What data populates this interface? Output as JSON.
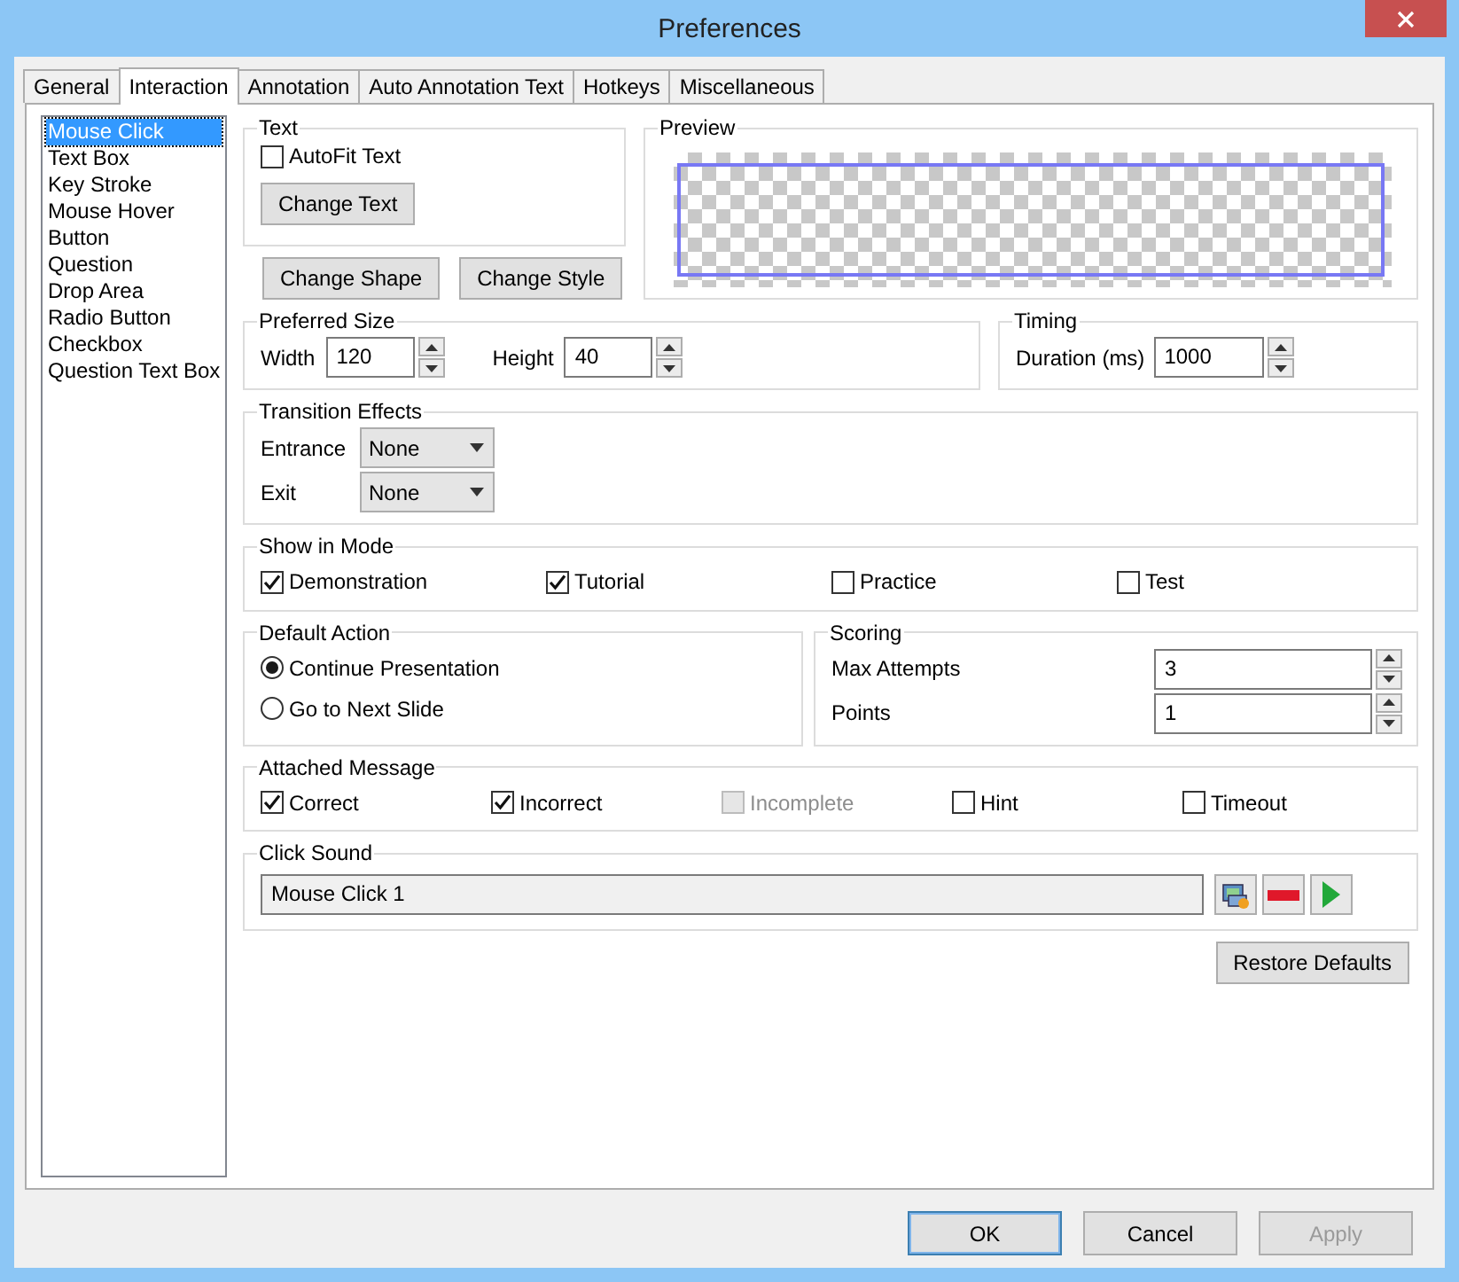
{
  "window": {
    "title": "Preferences"
  },
  "tabs": [
    {
      "label": "General",
      "selected": false
    },
    {
      "label": "Interaction",
      "selected": true
    },
    {
      "label": "Annotation",
      "selected": false
    },
    {
      "label": "Auto Annotation Text",
      "selected": false
    },
    {
      "label": "Hotkeys",
      "selected": false
    },
    {
      "label": "Miscellaneous",
      "selected": false
    }
  ],
  "sidebar": {
    "items": [
      {
        "label": "Mouse Click",
        "selected": true
      },
      {
        "label": "Text Box",
        "selected": false
      },
      {
        "label": "Key Stroke",
        "selected": false
      },
      {
        "label": "Mouse Hover",
        "selected": false
      },
      {
        "label": "Button",
        "selected": false
      },
      {
        "label": "Question",
        "selected": false
      },
      {
        "label": "Drop Area",
        "selected": false
      },
      {
        "label": "Radio Button",
        "selected": false
      },
      {
        "label": "Checkbox",
        "selected": false
      },
      {
        "label": "Question Text Box",
        "selected": false
      }
    ]
  },
  "text_group": {
    "title": "Text",
    "autofit": {
      "label": "AutoFit Text",
      "checked": false
    },
    "change_text_button": "Change Text"
  },
  "shape_buttons": [
    "Change Shape",
    "Change Style"
  ],
  "preview": {
    "title": "Preview"
  },
  "preferred_size": {
    "title": "Preferred Size",
    "fields": [
      {
        "label": "Width",
        "value": "120"
      },
      {
        "label": "Height",
        "value": "40"
      }
    ]
  },
  "timing": {
    "title": "Timing",
    "fields": [
      {
        "label": "Duration (ms)",
        "value": "1000"
      }
    ]
  },
  "transition_effects": {
    "title": "Transition Effects",
    "fields": [
      {
        "label": "Entrance",
        "value": "None"
      },
      {
        "label": "Exit",
        "value": "None"
      }
    ]
  },
  "show_in_mode": {
    "title": "Show in Mode",
    "options": [
      {
        "label": "Demonstration",
        "checked": true
      },
      {
        "label": "Tutorial",
        "checked": true
      },
      {
        "label": "Practice",
        "checked": false
      },
      {
        "label": "Test",
        "checked": false
      }
    ]
  },
  "default_action": {
    "title": "Default Action",
    "options": [
      {
        "label": "Continue Presentation",
        "selected": true
      },
      {
        "label": "Go to Next Slide",
        "selected": false
      }
    ]
  },
  "scoring": {
    "title": "Scoring",
    "fields": [
      {
        "label": "Max Attempts",
        "value": "3"
      },
      {
        "label": "Points",
        "value": "1"
      }
    ]
  },
  "attached_message": {
    "title": "Attached Message",
    "options": [
      {
        "label": "Correct",
        "checked": true,
        "disabled": false
      },
      {
        "label": "Incorrect",
        "checked": true,
        "disabled": false
      },
      {
        "label": "Incomplete",
        "checked": false,
        "disabled": true
      },
      {
        "label": "Hint",
        "checked": false,
        "disabled": false
      },
      {
        "label": "Timeout",
        "checked": false,
        "disabled": false
      }
    ]
  },
  "click_sound": {
    "title": "Click Sound",
    "value": "Mouse Click 1"
  },
  "restore_defaults": "Restore Defaults",
  "buttons": [
    {
      "label": "OK",
      "disabled": false,
      "selected": true
    },
    {
      "label": "Cancel",
      "disabled": false,
      "selected": false
    },
    {
      "label": "Apply",
      "disabled": true,
      "selected": false
    }
  ]
}
